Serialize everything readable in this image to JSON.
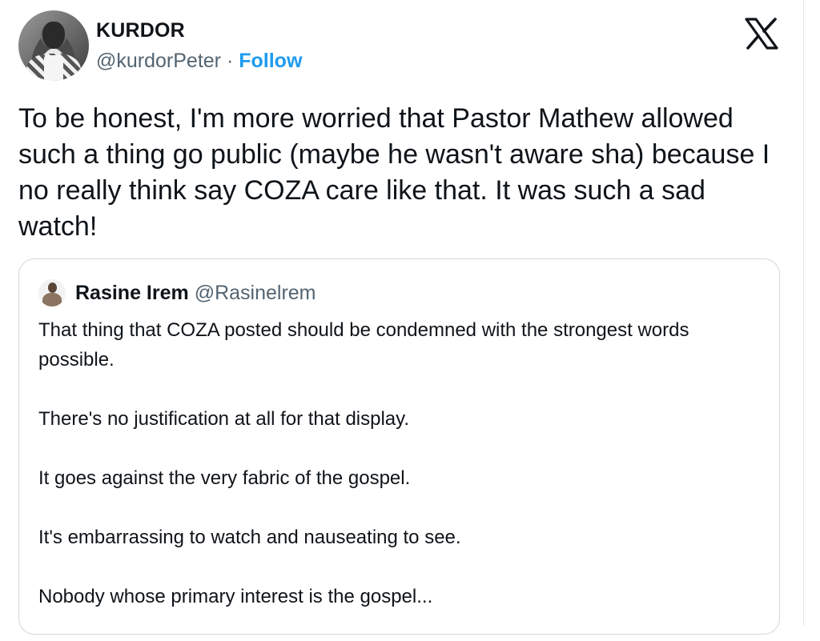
{
  "author": {
    "display_name": "KURDOR",
    "handle": "@kurdorPeter",
    "separator": "·",
    "follow_label": "Follow"
  },
  "brand": {
    "icon": "x-logo-icon",
    "color": "#0f1419"
  },
  "tweet": {
    "text": "To be honest, I'm more worried that Pastor Mathew allowed such a thing go public (maybe he wasn't aware sha) because I no really think say COZA care like that. It was such a sad watch!"
  },
  "quoted_tweet": {
    "display_name": "Rasine Irem",
    "handle": "@Rasinelrem",
    "paragraphs": [
      "That thing that COZA posted should be condemned with the strongest words possible.",
      "There's no justification at all for that display.",
      "It goes against the very fabric of the gospel.",
      "It's embarrassing to watch and nauseating to see.",
      "Nobody whose primary interest is the gospel..."
    ]
  },
  "colors": {
    "accent": "#1d9bf0",
    "secondary_text": "#536471",
    "border": "#cfd9de"
  }
}
